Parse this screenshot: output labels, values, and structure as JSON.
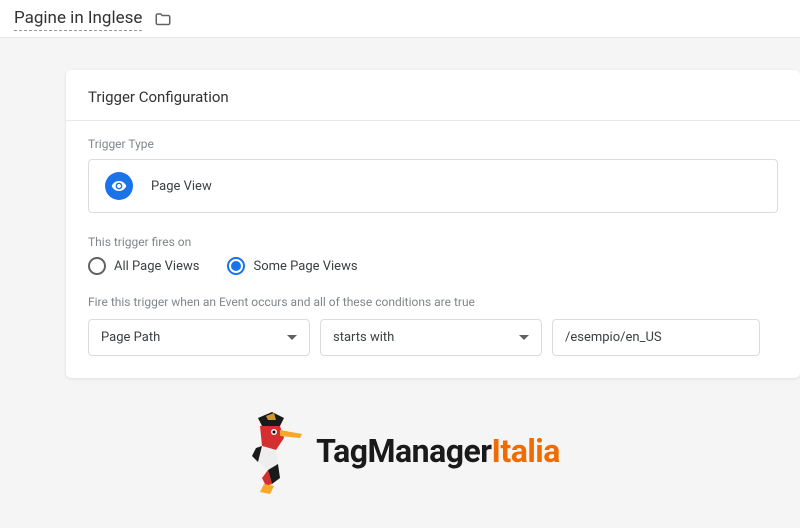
{
  "header": {
    "title": "Pagine in Inglese"
  },
  "card": {
    "section_title": "Trigger Configuration",
    "trigger_type_label": "Trigger Type",
    "trigger_type_name": "Page View",
    "fires_on_label": "This trigger fires on",
    "radio_all": "All Page Views",
    "radio_some": "Some Page Views",
    "condition_label": "Fire this trigger when an Event occurs and all of these conditions are true",
    "variable": "Page Path",
    "operator": "starts with",
    "value": "/esempio/en_US"
  },
  "logo": {
    "part1": "TagManager",
    "part2": "Italia"
  }
}
